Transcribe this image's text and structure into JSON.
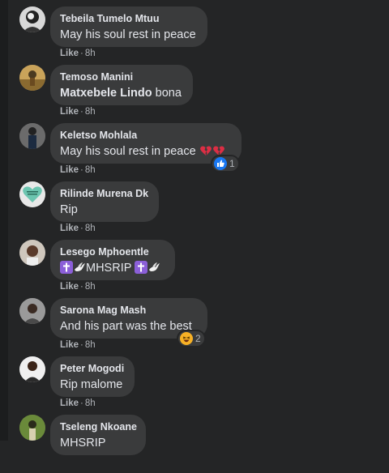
{
  "comments": [
    {
      "author": "Tebeila Tumelo Mtuu",
      "text": "May his soul rest in peace",
      "like": "Like",
      "time": "8h"
    },
    {
      "author": "Temoso Manini",
      "text_name": "Matxebele Lindo",
      "text_rest": " bona",
      "like": "Like",
      "time": "8h"
    },
    {
      "author": "Keletso Mohlala",
      "text": "May his soul rest in peace",
      "like": "Like",
      "time": "8h",
      "reaction_count": "1",
      "reaction_type": "like-icon"
    },
    {
      "author": "Rilinde Murena Dk",
      "text": "Rip",
      "like": "Like",
      "time": "8h"
    },
    {
      "author": "Lesego Mphoentle",
      "text": "MHSRIP",
      "like": "Like",
      "time": "8h"
    },
    {
      "author": "Sarona Mag Mash",
      "text": "And his part was the best",
      "like": "Like",
      "time": "8h",
      "reaction_count": "2",
      "reaction_type": "haha-icon"
    },
    {
      "author": "Peter Mogodi",
      "text": "Rip malome",
      "like": "Like",
      "time": "8h"
    },
    {
      "author": "Tseleng Nkoane",
      "text": "MHSRIP",
      "like": "",
      "time": ""
    }
  ],
  "separator": "·",
  "colors": {
    "background": "#242526",
    "bubble": "#3a3b3c",
    "text": "#e4e6eb",
    "muted": "#b0b3b8",
    "like_blue": "#1877f2"
  }
}
